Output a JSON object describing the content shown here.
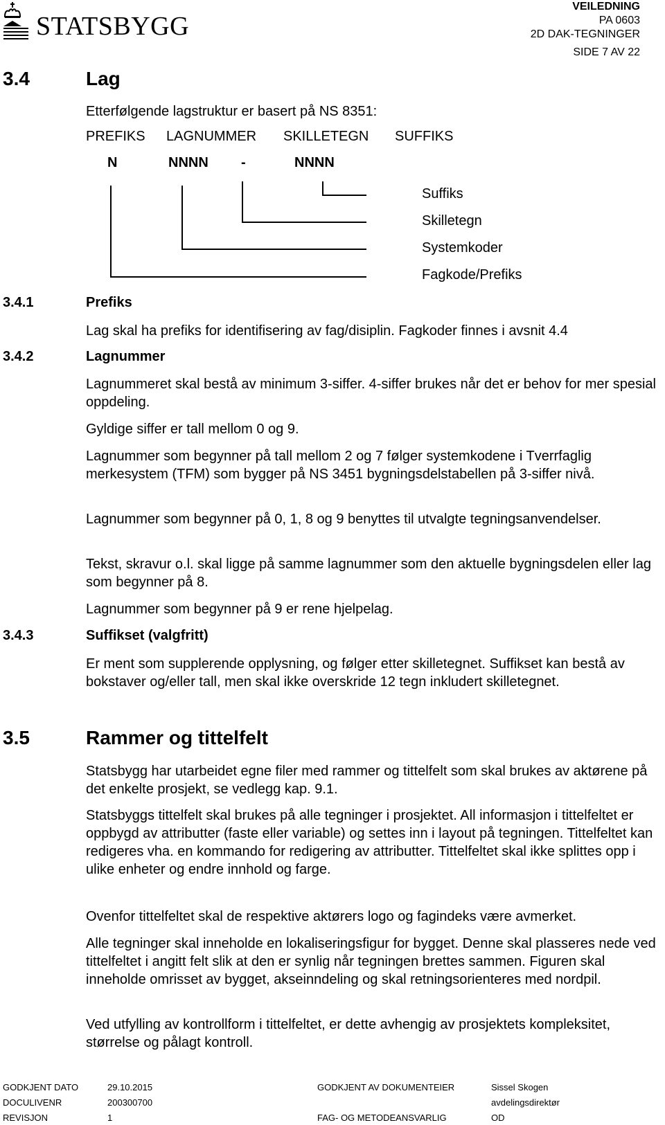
{
  "header": {
    "logo_text": "STATSBYGG",
    "doc_type": "VEILEDNING",
    "doc_code": "PA 0603",
    "doc_title": "2D DAK-TEGNINGER",
    "page_info": "SIDE 7 AV 22"
  },
  "section_3_4": {
    "number": "3.4",
    "title": "Lag",
    "intro": "Etterfølgende lagstruktur er basert på NS 8351:",
    "structure_headers": [
      "PREFIKS",
      "LAGNUMMER",
      "SKILLETEGN",
      "SUFFIKS"
    ],
    "structure_codes": [
      "N",
      "NNNN",
      "-",
      "NNNN"
    ],
    "diagram_labels": [
      "Suffiks",
      "Skilletegn",
      "Systemkoder",
      "Fagkode/Prefiks"
    ]
  },
  "section_3_4_1": {
    "number": "3.4.1",
    "title": "Prefiks",
    "paragraphs": [
      "Lag skal ha prefiks for identifisering av fag/disiplin.  Fagkoder finnes i avsnit 4.4"
    ]
  },
  "section_3_4_2": {
    "number": "3.4.2",
    "title": "Lagnummer",
    "paragraphs": [
      "Lagnummeret skal bestå av minimum 3-siffer.  4-siffer brukes når det er behov for mer spesial oppdeling.",
      "Gyldige siffer er tall mellom 0 og 9.",
      "Lagnummer som begynner på tall mellom 2 og 7 følger systemkodene i Tverrfaglig merkesystem (TFM) som bygger på NS 3451 bygningsdelstabellen på 3-siffer nivå.",
      "Lagnummer som begynner på 0, 1, 8 og 9 benyttes til utvalgte tegningsanvendelser.",
      "Tekst, skravur o.l. skal ligge på samme lagnummer som den aktuelle bygningsdelen eller lag som begynner på 8.",
      "Lagnummer som begynner på 9 er rene hjelpelag."
    ]
  },
  "section_3_4_3": {
    "number": "3.4.3",
    "title": "Suffikset (valgfritt)",
    "paragraphs": [
      "Er ment som supplerende opplysning, og følger etter skilletegnet. Suffikset kan bestå av bokstaver og/eller tall, men skal ikke overskride 12 tegn inkludert skilletegnet."
    ]
  },
  "section_3_5": {
    "number": "3.5",
    "title": "Rammer og tittelfelt",
    "paragraphs": [
      "Statsbygg har utarbeidet egne filer med rammer og tittelfelt som skal brukes av aktørene på det enkelte prosjekt, se vedlegg kap. 9.1.",
      "Statsbyggs tittelfelt skal brukes på alle tegninger i prosjektet. All informasjon i tittelfeltet er oppbygd av attributter (faste eller variable) og settes inn i layout på tegningen. Tittelfeltet kan redigeres vha. en kommando for redigering av attributter. Tittelfeltet skal ikke splittes opp i ulike enheter og endre innhold og farge.",
      "Ovenfor tittelfeltet skal de respektive aktørers logo og fagindeks være avmerket.",
      "Alle tegninger skal inneholde en lokaliseringsfigur for bygget. Denne skal plasseres nede ved tittelfeltet i angitt felt slik at den er synlig når tegningen brettes sammen. Figuren skal inneholde omrisset av bygget, akseinndeling og skal retningsorienteres med nordpil.",
      "Ved utfylling av  kontrollform i tittelfeltet, er dette avhengig av prosjektets kompleksitet, størrelse og pålagt kontroll."
    ]
  },
  "footer": {
    "approved_date_label": "GODKJENT DATO",
    "approved_date": "29.10.2015",
    "doculive_label": "DOCULIVENR",
    "doculive": "200300700",
    "revision_label": "REVISJON",
    "revision": "1",
    "owner_label": "GODKJENT AV DOKUMENTEIER",
    "owner_name": "Sissel Skogen",
    "owner_title": "avdelingsdirektør",
    "method_label": "FAG- OG METODEANSVARLIG",
    "method_value": "OD"
  }
}
